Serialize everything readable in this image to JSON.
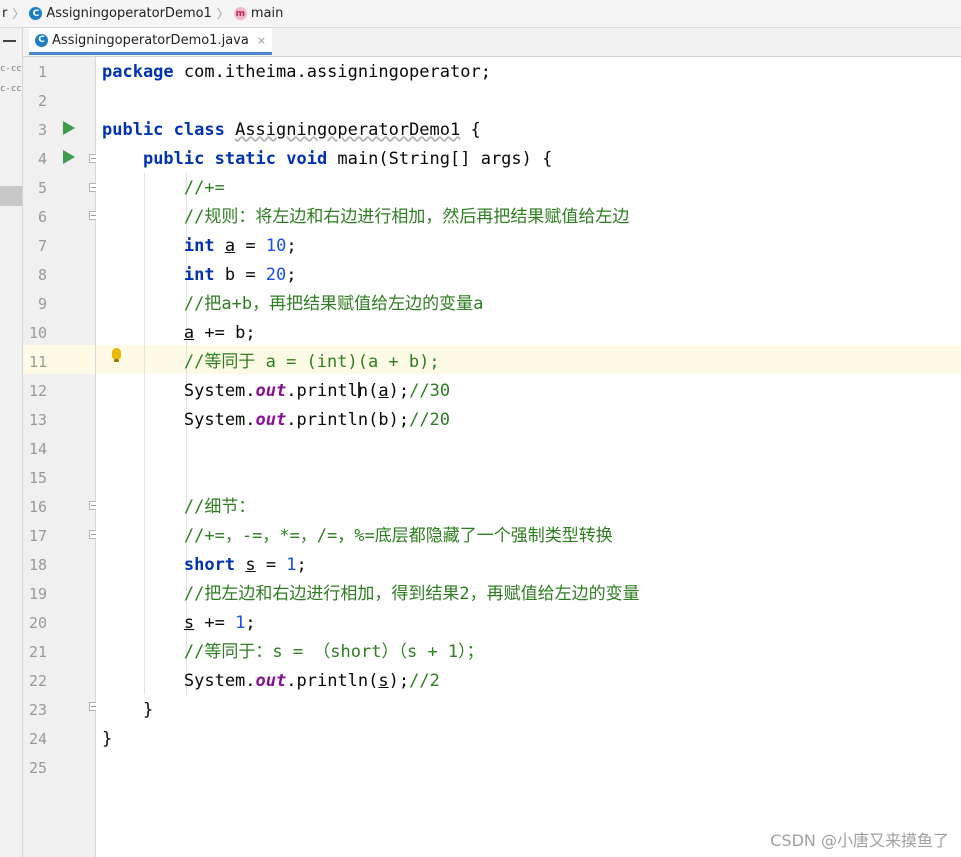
{
  "breadcrumb": {
    "items": [
      {
        "label": "r",
        "icon": ""
      },
      {
        "label": "AssigningoperatorDemo1",
        "icon": "class-icon"
      },
      {
        "label": "main",
        "icon": "method-icon"
      }
    ]
  },
  "sidebar_strip": {
    "lines": [
      "c-cc",
      "c-cc"
    ]
  },
  "tab": {
    "label": "AssigningoperatorDemo1.java",
    "close": "×",
    "icon_letter": "C"
  },
  "icons": {
    "method_letter": "m"
  },
  "editor": {
    "lines": [
      {
        "n": "1",
        "tokens": [
          {
            "t": "package",
            "c": "kw"
          },
          {
            "t": " com.itheima.assigningoperator;",
            "c": ""
          }
        ]
      },
      {
        "n": "2",
        "tokens": []
      },
      {
        "n": "3",
        "tokens": [
          {
            "t": "public class",
            "c": "kw"
          },
          {
            "t": " ",
            "c": ""
          },
          {
            "t": "AssigningoperatorDemo1",
            "c": "wavy"
          },
          {
            "t": " {",
            "c": ""
          }
        ]
      },
      {
        "n": "4",
        "tokens": [
          {
            "t": "    ",
            "c": ""
          },
          {
            "t": "public static void",
            "c": "kw"
          },
          {
            "t": " main(String[] args) {",
            "c": ""
          }
        ]
      },
      {
        "n": "5",
        "tokens": [
          {
            "t": "        ",
            "c": ""
          },
          {
            "t": "//+=",
            "c": "cm"
          }
        ]
      },
      {
        "n": "6",
        "tokens": [
          {
            "t": "        ",
            "c": ""
          },
          {
            "t": "//规则：将左边和右边进行相加，然后再把结果赋值给左边",
            "c": "cm"
          }
        ]
      },
      {
        "n": "7",
        "tokens": [
          {
            "t": "        ",
            "c": ""
          },
          {
            "t": "int",
            "c": "kw"
          },
          {
            "t": " ",
            "c": ""
          },
          {
            "t": "a",
            "c": "ul"
          },
          {
            "t": " = ",
            "c": ""
          },
          {
            "t": "10",
            "c": "num"
          },
          {
            "t": ";",
            "c": ""
          }
        ]
      },
      {
        "n": "8",
        "tokens": [
          {
            "t": "        ",
            "c": ""
          },
          {
            "t": "int",
            "c": "kw"
          },
          {
            "t": " b = ",
            "c": ""
          },
          {
            "t": "20",
            "c": "num"
          },
          {
            "t": ";",
            "c": ""
          }
        ]
      },
      {
        "n": "9",
        "tokens": [
          {
            "t": "        ",
            "c": ""
          },
          {
            "t": "//把a+b，再把结果赋值给左边的变量a",
            "c": "cm"
          }
        ]
      },
      {
        "n": "10",
        "tokens": [
          {
            "t": "        ",
            "c": ""
          },
          {
            "t": "a",
            "c": "ul"
          },
          {
            "t": " += b;",
            "c": ""
          }
        ]
      },
      {
        "n": "11",
        "tokens": [
          {
            "t": "        ",
            "c": ""
          },
          {
            "t": "//等同于 a = (int)(a + b);",
            "c": "cm"
          }
        ]
      },
      {
        "n": "12",
        "tokens": [
          {
            "t": "        System.",
            "c": ""
          },
          {
            "t": "out",
            "c": "fld"
          },
          {
            "t": ".println(",
            "c": ""
          },
          {
            "t": "a",
            "c": "ul"
          },
          {
            "t": ");",
            "c": ""
          },
          {
            "t": "//30",
            "c": "cm"
          }
        ]
      },
      {
        "n": "13",
        "tokens": [
          {
            "t": "        System.",
            "c": ""
          },
          {
            "t": "out",
            "c": "fld"
          },
          {
            "t": ".println(b);",
            "c": ""
          },
          {
            "t": "//20",
            "c": "cm"
          }
        ]
      },
      {
        "n": "14",
        "tokens": []
      },
      {
        "n": "15",
        "tokens": []
      },
      {
        "n": "16",
        "tokens": [
          {
            "t": "        ",
            "c": ""
          },
          {
            "t": "//细节：",
            "c": "cm"
          }
        ]
      },
      {
        "n": "17",
        "tokens": [
          {
            "t": "        ",
            "c": ""
          },
          {
            "t": "//+=，-=，*=，/=，%=底层都隐藏了一个强制类型转换",
            "c": "cm"
          }
        ]
      },
      {
        "n": "18",
        "tokens": [
          {
            "t": "        ",
            "c": ""
          },
          {
            "t": "short",
            "c": "kw"
          },
          {
            "t": " ",
            "c": ""
          },
          {
            "t": "s",
            "c": "ul"
          },
          {
            "t": " = ",
            "c": ""
          },
          {
            "t": "1",
            "c": "num"
          },
          {
            "t": ";",
            "c": ""
          }
        ]
      },
      {
        "n": "19",
        "tokens": [
          {
            "t": "        ",
            "c": ""
          },
          {
            "t": "//把左边和右边进行相加，得到结果2，再赋值给左边的变量",
            "c": "cm"
          }
        ]
      },
      {
        "n": "20",
        "tokens": [
          {
            "t": "        ",
            "c": ""
          },
          {
            "t": "s",
            "c": "ul"
          },
          {
            "t": " += ",
            "c": ""
          },
          {
            "t": "1",
            "c": "num"
          },
          {
            "t": ";",
            "c": ""
          }
        ]
      },
      {
        "n": "21",
        "tokens": [
          {
            "t": "        ",
            "c": ""
          },
          {
            "t": "//等同于：s = （short）（s + 1）；",
            "c": "cm"
          }
        ]
      },
      {
        "n": "22",
        "tokens": [
          {
            "t": "        System.",
            "c": ""
          },
          {
            "t": "out",
            "c": "fld"
          },
          {
            "t": ".println(",
            "c": ""
          },
          {
            "t": "s",
            "c": "ul"
          },
          {
            "t": ");",
            "c": ""
          },
          {
            "t": "//2",
            "c": "cm"
          }
        ]
      },
      {
        "n": "23",
        "tokens": [
          {
            "t": "    }",
            "c": ""
          }
        ]
      },
      {
        "n": "24",
        "tokens": [
          {
            "t": "}",
            "c": ""
          }
        ]
      },
      {
        "n": "25",
        "tokens": []
      }
    ]
  },
  "watermark": "CSDN @小唐又来摸鱼了",
  "colors": {
    "keyword": "#0033b3",
    "comment": "#2e7d21",
    "number": "#1750eb",
    "field": "#871094",
    "run_icon": "#3e9a4c",
    "current_line": "#fdfbe6"
  }
}
